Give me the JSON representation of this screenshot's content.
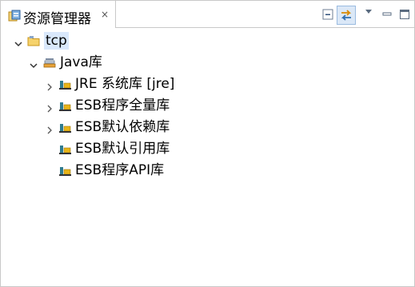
{
  "tab": {
    "title": "资源管理器",
    "close_symbol": "×",
    "icon": "package-explorer-icon"
  },
  "toolbar": {
    "buttons": [
      "collapse-all-icon",
      "link-with-editor-icon",
      "view-menu-icon",
      "minimize-icon",
      "maximize-icon"
    ]
  },
  "tree": {
    "root": {
      "label": "tcp",
      "icon": "project-folder-icon",
      "expanded": true,
      "selected": true
    },
    "java_lib": {
      "label": "Java库",
      "icon": "library-container-icon",
      "expanded": true
    },
    "libs": [
      {
        "label": "JRE 系统库 [jre]",
        "icon": "library-icon",
        "expandable": true
      },
      {
        "label": "ESB程序全量库",
        "icon": "library-icon",
        "expandable": true
      },
      {
        "label": "ESB默认依赖库",
        "icon": "library-icon",
        "expandable": true
      },
      {
        "label": "ESB默认引用库",
        "icon": "library-icon",
        "expandable": false
      },
      {
        "label": "ESB程序API库",
        "icon": "library-icon",
        "expandable": false
      }
    ]
  },
  "colors": {
    "selection": "#d9e8fb",
    "border": "#c9c9c9",
    "library_yellow": "#e8b417",
    "library_teal": "#2f7c8f"
  }
}
